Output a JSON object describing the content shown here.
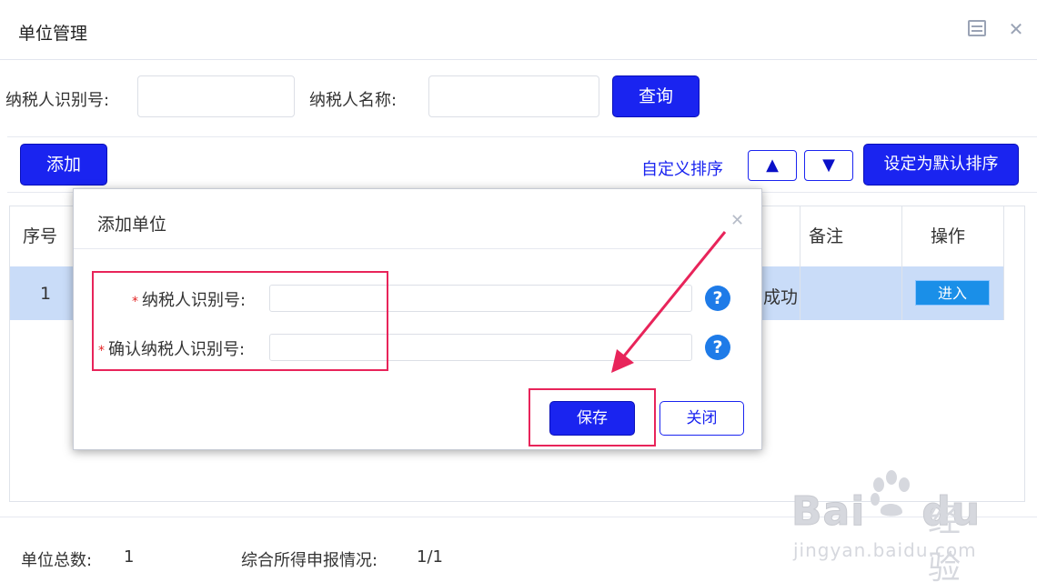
{
  "window": {
    "title": "单位管理"
  },
  "search": {
    "taxpayer_id_label": "纳税人识别号:",
    "taxpayer_id_value": "",
    "taxpayer_name_label": "纳税人名称:",
    "taxpayer_name_value": "",
    "query_button": "查询"
  },
  "toolbar": {
    "add_button": "添加",
    "custom_sort_label": "自定义排序",
    "sort_up": "▲",
    "sort_down": "▼",
    "set_default_sort_button": "设定为默认排序"
  },
  "table": {
    "columns": {
      "index": "序号",
      "remark": "备注",
      "action": "操作"
    },
    "rows": [
      {
        "index": "1",
        "status_tail": "成功",
        "remark": "",
        "action_button": "进入"
      }
    ]
  },
  "footer": {
    "unit_total_label": "单位总数:",
    "unit_total_value": "1",
    "declaration_label": "综合所得申报情况:",
    "declaration_value": "1/1"
  },
  "dialog": {
    "title": "添加单位",
    "required_mark": "*",
    "taxpayer_id_label": "纳税人识别号:",
    "confirm_taxpayer_id_label": "确认纳税人识别号:",
    "taxpayer_id_value": "",
    "confirm_taxpayer_id_value": "",
    "help_glyph": "?",
    "save_button": "保存",
    "close_button": "关闭"
  },
  "watermark": {
    "brand": "Bai",
    "brand_tail": "du",
    "brand_cn": "经验",
    "url": "jingyan.baidu.com"
  },
  "colors": {
    "primary": "#1a24f0",
    "selected_row": "#c9dcf8",
    "highlight": "#e8245a",
    "help_icon": "#1e7be8"
  },
  "icons": [
    "window-menu-icon",
    "window-close-icon",
    "dialog-close-icon",
    "help-icon",
    "paw-logo-icon"
  ]
}
